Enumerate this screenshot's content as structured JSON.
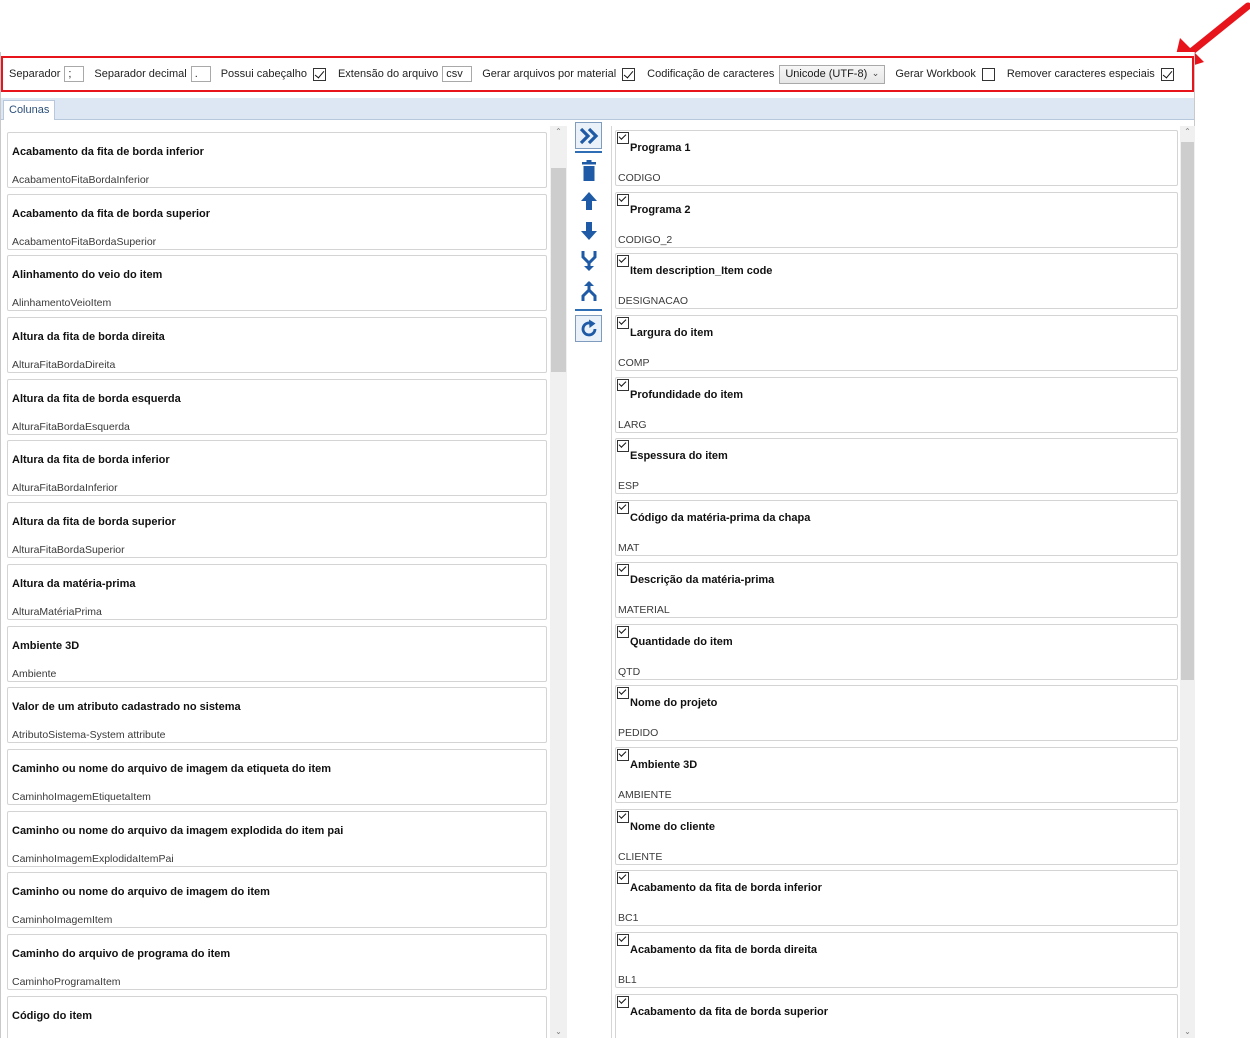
{
  "toolbar": {
    "separator_label": "Separador",
    "separator_value": ";",
    "decimal_label": "Separador decimal",
    "decimal_value": ".",
    "header_label": "Possui cabeçalho",
    "header_checked": true,
    "ext_label": "Extensão do arquivo",
    "ext_value": "csv",
    "per_material_label": "Gerar arquivos por material",
    "per_material_checked": true,
    "encoding_label": "Codificação de caracteres",
    "encoding_value": "Unicode (UTF-8)",
    "workbook_label": "Gerar Workbook",
    "workbook_checked": false,
    "remove_special_label": "Remover caracteres especiais",
    "remove_special_checked": true
  },
  "tabs": [
    {
      "label": "Colunas"
    }
  ],
  "available_columns": [
    {
      "title": "Acabamento da fita de borda inferior",
      "field": "AcabamentoFitaBordaInferior"
    },
    {
      "title": "Acabamento da fita de borda superior",
      "field": "AcabamentoFitaBordaSuperior"
    },
    {
      "title": "Alinhamento do veio do item",
      "field": "AlinhamentoVeioItem"
    },
    {
      "title": "Altura da fita de borda direita",
      "field": "AlturaFitaBordaDireita"
    },
    {
      "title": "Altura da fita de borda esquerda",
      "field": "AlturaFitaBordaEsquerda"
    },
    {
      "title": "Altura da fita de borda inferior",
      "field": "AlturaFitaBordaInferior"
    },
    {
      "title": "Altura da fita de borda superior",
      "field": "AlturaFitaBordaSuperior"
    },
    {
      "title": "Altura da matéria-prima",
      "field": "AlturaMatériaPrima"
    },
    {
      "title": "Ambiente 3D",
      "field": "Ambiente"
    },
    {
      "title": "Valor de um atributo cadastrado no sistema",
      "field": "AtributoSistema-System attribute"
    },
    {
      "title": "Caminho ou nome do arquivo de imagem da etiqueta do item",
      "field": "CaminhoImagemEtiquetaItem"
    },
    {
      "title": "Caminho ou nome do arquivo da imagem explodida do item pai",
      "field": "CaminhoImagemExplodidaItemPai"
    },
    {
      "title": "Caminho ou nome do arquivo de imagem do item",
      "field": "CaminhoImagemItem"
    },
    {
      "title": "Caminho do arquivo de programa do item",
      "field": "CaminhoProgramaItem"
    },
    {
      "title": "Código do item",
      "field": ""
    }
  ],
  "selected_columns": [
    {
      "title": "Programa 1",
      "field": "CODIGO"
    },
    {
      "title": "Programa 2",
      "field": "CODIGO_2"
    },
    {
      "title": "Item description_Item code",
      "field": "DESIGNACAO"
    },
    {
      "title": "Largura do item",
      "field": "COMP"
    },
    {
      "title": "Profundidade do item",
      "field": "LARG"
    },
    {
      "title": "Espessura do item",
      "field": "ESP"
    },
    {
      "title": "Código da matéria-prima da chapa",
      "field": "MAT"
    },
    {
      "title": "Descrição da matéria-prima",
      "field": "MATERIAL"
    },
    {
      "title": "Quantidade do item",
      "field": "QTD"
    },
    {
      "title": "Nome do projeto",
      "field": "PEDIDO"
    },
    {
      "title": "Ambiente 3D",
      "field": "AMBIENTE"
    },
    {
      "title": "Nome do cliente",
      "field": "CLIENTE"
    },
    {
      "title": "Acabamento da fita de borda inferior",
      "field": "BC1"
    },
    {
      "title": "Acabamento da fita de borda direita",
      "field": "BL1"
    },
    {
      "title": "Acabamento da fita de borda superior",
      "field": ""
    }
  ],
  "middle_buttons": [
    {
      "name": "add-all-button",
      "icon": "double-chevron-right-icon"
    },
    {
      "name": "delete-button",
      "icon": "trash-icon"
    },
    {
      "name": "move-up-button",
      "icon": "arrow-up-icon"
    },
    {
      "name": "move-down-button",
      "icon": "arrow-down-icon"
    },
    {
      "name": "merge-button",
      "icon": "merge-icon"
    },
    {
      "name": "split-button",
      "icon": "split-icon"
    },
    {
      "name": "refresh-button",
      "icon": "refresh-icon"
    }
  ],
  "colors": {
    "highlight_border": "#e8141c",
    "accent_blue": "#1f5aa6",
    "tab_strip": "#dce7f3"
  }
}
